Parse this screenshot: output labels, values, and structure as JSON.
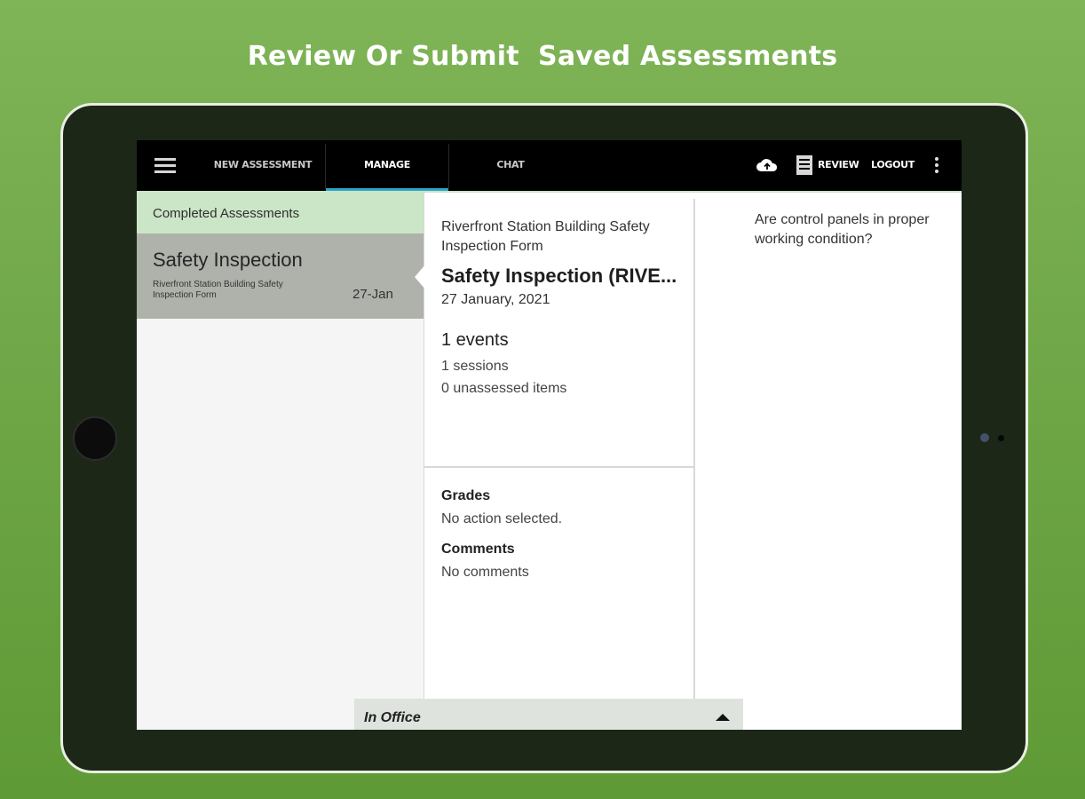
{
  "headline": "Review Or Submit  Saved Assessments",
  "appbar": {
    "tabs": [
      {
        "label": "NEW ASSESSMENT"
      },
      {
        "label": "MANAGE"
      },
      {
        "label": "CHAT"
      }
    ],
    "review_label": "REVIEW",
    "logout_label": "LOGOUT",
    "active_tab_color": "#2ea6c8"
  },
  "list": {
    "header": "Completed Assessments",
    "items": [
      {
        "title": "Safety Inspection",
        "subtitle": "Riverfront Station Building Safety Inspection Form",
        "date": "27-Jan"
      }
    ]
  },
  "detail": {
    "form_name": "Riverfront Station Building Safety Inspection Form",
    "title": "Safety Inspection (RIVE...",
    "date": "27 January, 2021",
    "events": "1 events",
    "sessions": "1 sessions",
    "unassessed": "0 unassessed items",
    "grades_label": "Grades",
    "grades_value": "No action selected.",
    "comments_label": "Comments",
    "comments_value": "No comments"
  },
  "question": "Are control panels in proper working condition?",
  "status": {
    "label": "In Office"
  },
  "colors": {
    "background_green": "#6fa646",
    "list_header_bg": "#cbe6c6",
    "selected_item_bg": "#aeb2ab"
  }
}
